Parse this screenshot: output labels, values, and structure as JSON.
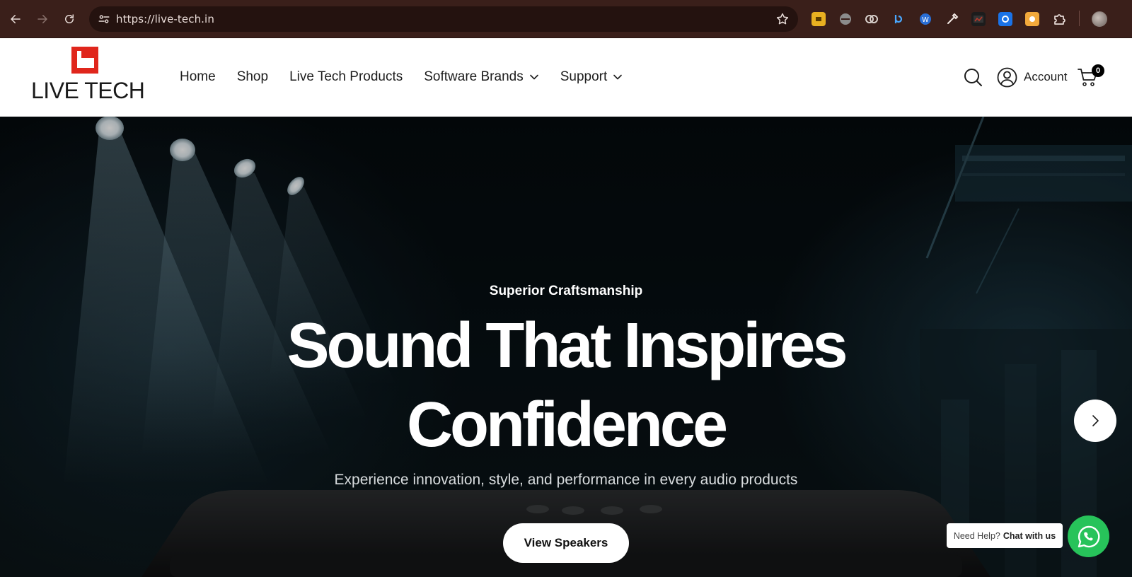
{
  "browser": {
    "url": "https://live-tech.in",
    "extensions": [
      "extension-icon-1",
      "extension-icon-2",
      "extension-icon-3",
      "extension-icon-4",
      "extension-icon-5",
      "eyedropper-icon",
      "extension-icon-7",
      "extension-icon-8",
      "extension-icon-9",
      "puzzle-icon"
    ]
  },
  "header": {
    "logo_text": "LIVE TECH",
    "nav": [
      {
        "label": "Home"
      },
      {
        "label": "Shop"
      },
      {
        "label": "Live Tech Products"
      },
      {
        "label": "Software Brands"
      },
      {
        "label": "Support"
      }
    ],
    "account_label": "Account",
    "cart_count": "0"
  },
  "hero": {
    "eyebrow": "Superior Craftsmanship",
    "title_line1": "Sound That Inspires",
    "title_line2": "Confidence",
    "subtitle": "Experience innovation, style, and performance in every audio products",
    "cta_label": "View Speakers"
  },
  "chat": {
    "help_prefix": "Need Help?",
    "help_action": "Chat with us"
  },
  "colors": {
    "brand_red": "#e0261c",
    "whatsapp_green": "#27c35a",
    "browser_chrome": "#3a1f1a"
  }
}
